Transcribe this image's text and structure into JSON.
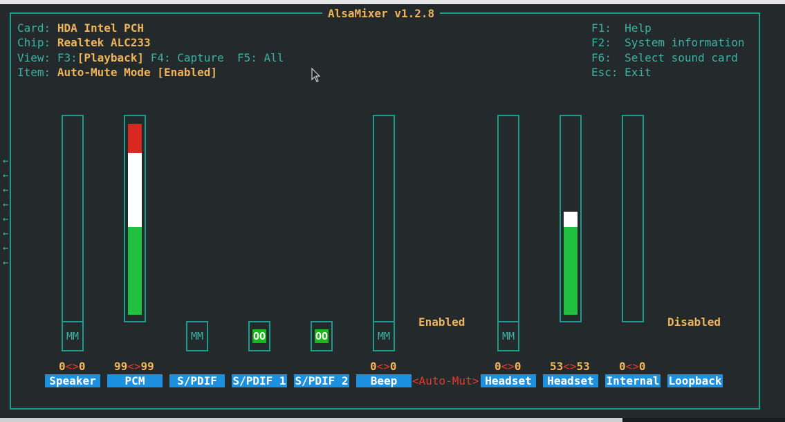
{
  "app_title": "AlsaMixer v1.2.8",
  "info": {
    "card_label": "Card:",
    "card_value": "HDA Intel PCH",
    "chip_label": "Chip:",
    "chip_value": "Realtek ALC233",
    "view_label": "View:",
    "f3": "F3:",
    "playback": "[Playback]",
    "f4": "F4:",
    "capture": "Capture",
    "f5": "F5:",
    "all": "All",
    "item_label": "Item:",
    "item_value": "Auto-Mute Mode [Enabled]"
  },
  "keys": [
    {
      "key": "F1:",
      "action": "Help"
    },
    {
      "key": "F2:",
      "action": "System information"
    },
    {
      "key": "F6:",
      "action": "Select sound card"
    },
    {
      "key": "Esc:",
      "action": "Exit"
    }
  ],
  "controls": [
    {
      "name": "Speaker",
      "level_left": "0",
      "level_right": "0",
      "mute": "MM",
      "volume_fraction": 0
    },
    {
      "name": "PCM",
      "level_left": "99",
      "level_right": "99",
      "volume_fraction": 0.99
    },
    {
      "name": "S/PDIF",
      "mute": "MM"
    },
    {
      "name": "S/PDIF 1",
      "mute": "OO"
    },
    {
      "name": "S/PDIF 2",
      "mute": "OO"
    },
    {
      "name": "Beep",
      "level_left": "0",
      "level_right": "0",
      "mute": "MM",
      "volume_fraction": 0
    },
    {
      "name": "<Auto-Mut>",
      "state": "Enabled",
      "selected": true
    },
    {
      "name": "Headset",
      "level_left": "0",
      "level_right": "0",
      "mute": "MM",
      "volume_fraction": 0
    },
    {
      "name": "Headset",
      "level_left": "53",
      "level_right": "53",
      "volume_fraction": 0.53
    },
    {
      "name": "Internal",
      "level_left": "0",
      "level_right": "0",
      "volume_fraction": 0
    },
    {
      "name": "Loopback",
      "state": "Disabled"
    }
  ],
  "level_separator": "<>",
  "scroll_arrow": "←",
  "colors": {
    "background": "#24292b",
    "frame": "#1c9c8e",
    "accent": "#f0b45a",
    "label_bg": "#1e90e0",
    "meter_green": "#20c040",
    "meter_white": "#ffffff",
    "meter_red": "#d8281f",
    "mute_on": "#19b81a"
  }
}
